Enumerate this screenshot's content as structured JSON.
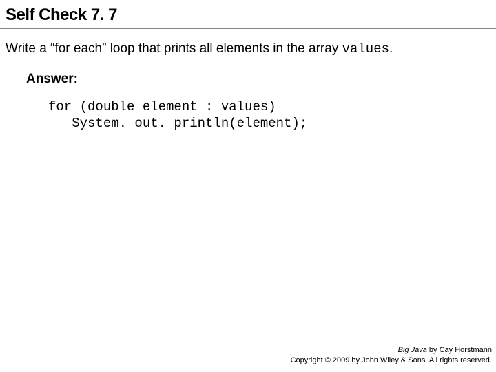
{
  "title": "Self Check 7. 7",
  "question": {
    "prefix": "Write a “for each” loop that prints all elements in the array ",
    "code": "values",
    "suffix": "."
  },
  "answer_label": "Answer:",
  "code_line1": "for (double element : values)",
  "code_line2": "   System. out. println(element);",
  "footer": {
    "book_title": "Big Java",
    "byline": " by Cay Horstmann",
    "copyright": "Copyright © 2009 by John Wiley & Sons. All rights reserved."
  }
}
